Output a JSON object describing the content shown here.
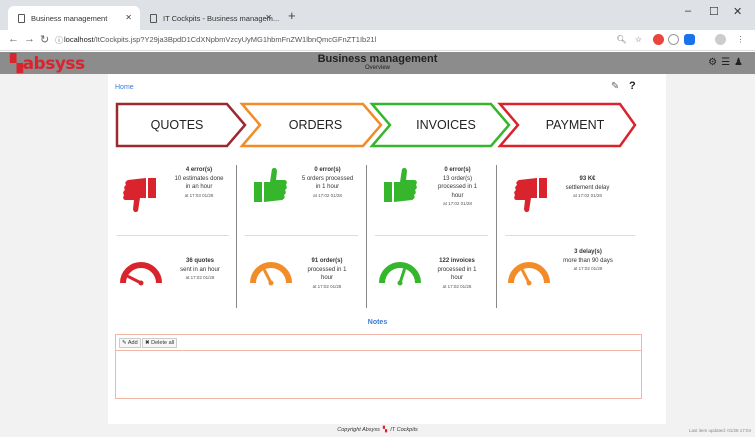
{
  "browser": {
    "tabs": [
      {
        "title": "Business management"
      },
      {
        "title": "IT Cockpits - Business managem..."
      }
    ],
    "new_tab": "+",
    "url_host": "localhost",
    "url_path": "/ItCockpits.jsp?Y29ja3BpdD1CdXNpbmVzcyUyMG1hbmFnZW1lbnQmcGFnZT1Ib21l",
    "window_controls": [
      "–",
      "☐",
      "✕"
    ]
  },
  "app": {
    "logo": "absyss",
    "title": "Business management",
    "subtitle": "Overview"
  },
  "breadcrumb": "Home",
  "steps": [
    {
      "label": "QUOTES",
      "color": "#9b2a2f"
    },
    {
      "label": "ORDERS",
      "color": "#f28c28"
    },
    {
      "label": "INVOICES",
      "color": "#35b62c"
    },
    {
      "label": "PAYMENT",
      "color": "#d9232d"
    }
  ],
  "status_top": [
    {
      "thumb": "down",
      "color": "#d9232d",
      "line1": "4 error(s)",
      "line2": "10 estimates done",
      "line3": "in an hour",
      "line4": "",
      "time": "at 17:03 01/28"
    },
    {
      "thumb": "up",
      "color": "#35b62c",
      "line1": "0 error(s)",
      "line2": "5 orders processed",
      "line3": "in 1 hour",
      "line4": "",
      "time": "at 17:02 01/28"
    },
    {
      "thumb": "up",
      "color": "#35b62c",
      "line1": "0 error(s)",
      "line2": "13 order(s)",
      "line3": "processed in 1",
      "line4": "hour",
      "time": "at 17:02 01/28"
    },
    {
      "thumb": "down",
      "color": "#d9232d",
      "line1": "93 K€",
      "line2": "settlement delay",
      "line3": "",
      "line4": "",
      "time": "at 17:02 01/28"
    }
  ],
  "status_bottom": [
    {
      "gauge_color": "#d9232d",
      "gauge_level": 0.15,
      "line1": "36 quotes",
      "line2": "sent in an hour",
      "line3": "",
      "line4": "",
      "time": "at 17:02 01/28"
    },
    {
      "gauge_color": "#f28c28",
      "gauge_level": 0.35,
      "line1": "91 order(s)",
      "line2": "processed in 1",
      "line3": "hour",
      "line4": "",
      "time": "at 17:02 01/28"
    },
    {
      "gauge_color": "#35b62c",
      "gauge_level": 0.6,
      "line1": "122 invoices",
      "line2": "processed in 1",
      "line3": "hour",
      "line4": "",
      "time": "at 17:02 01/28"
    },
    {
      "gauge_color": "#f28c28",
      "gauge_level": 0.35,
      "line1": "3 delay(s)",
      "line2": "more than 90 days",
      "line3": "",
      "line4": "",
      "time": "at 17:02 01/28"
    }
  ],
  "notes": {
    "title": "Notes",
    "add_label": "Add",
    "delete_label": "Delete all"
  },
  "footer": {
    "copyright": "Copyright Absyss",
    "product": "IT Cockpits",
    "last_update": "Last item updated: 01/28 17:04"
  }
}
